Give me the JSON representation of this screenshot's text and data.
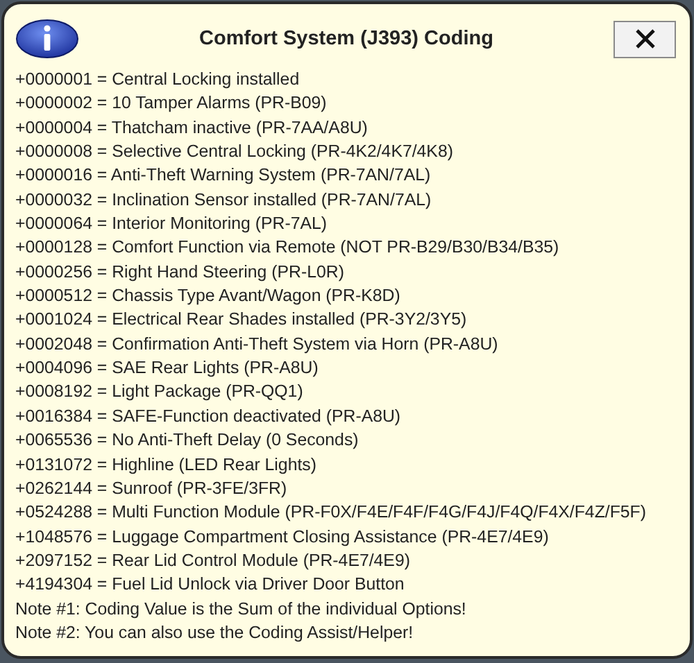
{
  "window": {
    "title": "Comfort System (J393) Coding"
  },
  "lines": [
    "+0000001 = Central Locking installed",
    "+0000002 = 10 Tamper Alarms (PR-B09)",
    "+0000004 = Thatcham inactive (PR-7AA/A8U)",
    "+0000008 = Selective Central Locking (PR-4K2/4K7/4K8)",
    "+0000016 = Anti-Theft Warning System (PR-7AN/7AL)",
    "+0000032 = Inclination Sensor installed (PR-7AN/7AL)",
    "+0000064 = Interior Monitoring (PR-7AL)",
    "+0000128 = Comfort Function via Remote (NOT PR-B29/B30/B34/B35)",
    "+0000256 = Right Hand Steering (PR-L0R)",
    "+0000512 = Chassis Type Avant/Wagon (PR-K8D)",
    "+0001024 = Electrical Rear Shades installed (PR-3Y2/3Y5)",
    "+0002048 = Confirmation Anti-Theft System via Horn (PR-A8U)",
    "+0004096 = SAE Rear Lights (PR-A8U)",
    "+0008192 = Light Package (PR-QQ1)",
    "+0016384 = SAFE-Function deactivated (PR-A8U)",
    "+0065536 = No Anti-Theft Delay (0 Seconds)",
    "+0131072 = Highline (LED Rear Lights)",
    "+0262144 = Sunroof (PR-3FE/3FR)",
    "+0524288 = Multi Function Module (PR-F0X/F4E/F4F/F4G/F4J/F4Q/F4X/F4Z/F5F)",
    "+1048576 = Luggage Compartment Closing Assistance (PR-4E7/4E9)",
    "+2097152 = Rear Lid Control Module (PR-4E7/4E9)",
    "+4194304 = Fuel Lid Unlock via Driver Door Button",
    "Note #1: Coding Value is the Sum of the individual Options!",
    "Note #2: You can also use the Coding Assist/Helper!"
  ]
}
